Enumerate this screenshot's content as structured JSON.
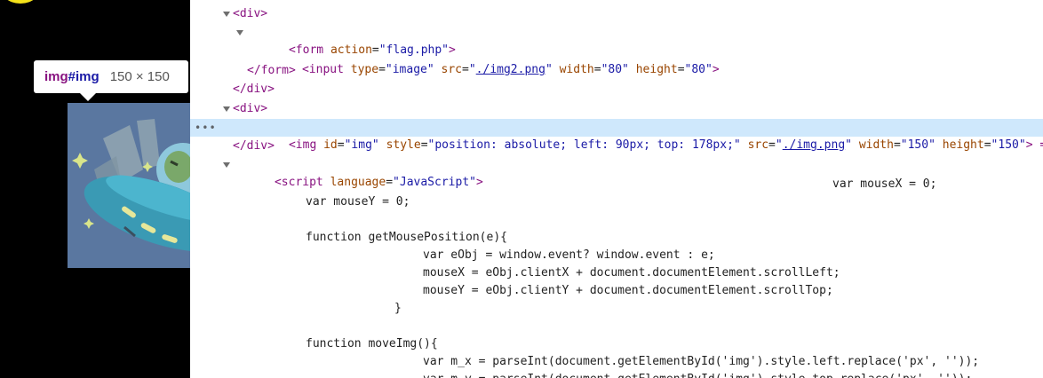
{
  "tooltip": {
    "tag": "img",
    "id": "#img",
    "size": "150 × 150"
  },
  "code": {
    "div_open_1": "<div>",
    "form_open_tag": "<form",
    "form_attr_name": "action",
    "form_attr_value": "\"flag.php\"",
    "form_close_bracket": ">",
    "input_open_tag": "<input",
    "input_attr_type": "type",
    "input_val_type": "\"image\"",
    "input_attr_src": "src",
    "input_val_src": "./img2.png",
    "input_attr_width": "width",
    "input_val_width": "\"80\"",
    "input_attr_height": "height",
    "input_val_height": "\"80\"",
    "input_close": ">",
    "form_close": "</form>",
    "div_close_1": "</div>",
    "div_open_2": "<div>",
    "img_open_tag": "<img",
    "img_attr_id": "id",
    "img_val_id": "\"img\"",
    "img_attr_style": "style",
    "img_val_style": "\"position: absolute; left: 90px; top: 178px;\"",
    "img_attr_src": "src",
    "img_val_src": "./img.png",
    "img_attr_width": "width",
    "img_val_width": "\"150\"",
    "img_attr_height": "height",
    "img_val_height": "\"150\"",
    "img_close": "> ==",
    "div_close_2": "</div>",
    "script_open_tag": "<script",
    "script_attr": "language",
    "script_val": "\"JavaScript\"",
    "script_close_bracket": ">",
    "js_lines": [
      "var mouseX = 0;",
      "var mouseY = 0;",
      "function getMousePosition(e){",
      "var eObj = window.event? window.event : e;",
      "mouseX = eObj.clientX + document.documentElement.scrollLeft;",
      "mouseY = eObj.clientY + document.documentElement.scrollTop;",
      "}",
      "function moveImg(){",
      "var m_x = parseInt(document.getElementById('img').style.left.replace('px', ''));",
      "var m_y = parseInt(document.getElementById('img').style.top.replace('px', ''));"
    ],
    "selected_dots": "•••"
  },
  "colors": {
    "tag": "#881280",
    "attr": "#994500",
    "value": "#1a1aa6",
    "selected_row": "#cfe8fc"
  }
}
